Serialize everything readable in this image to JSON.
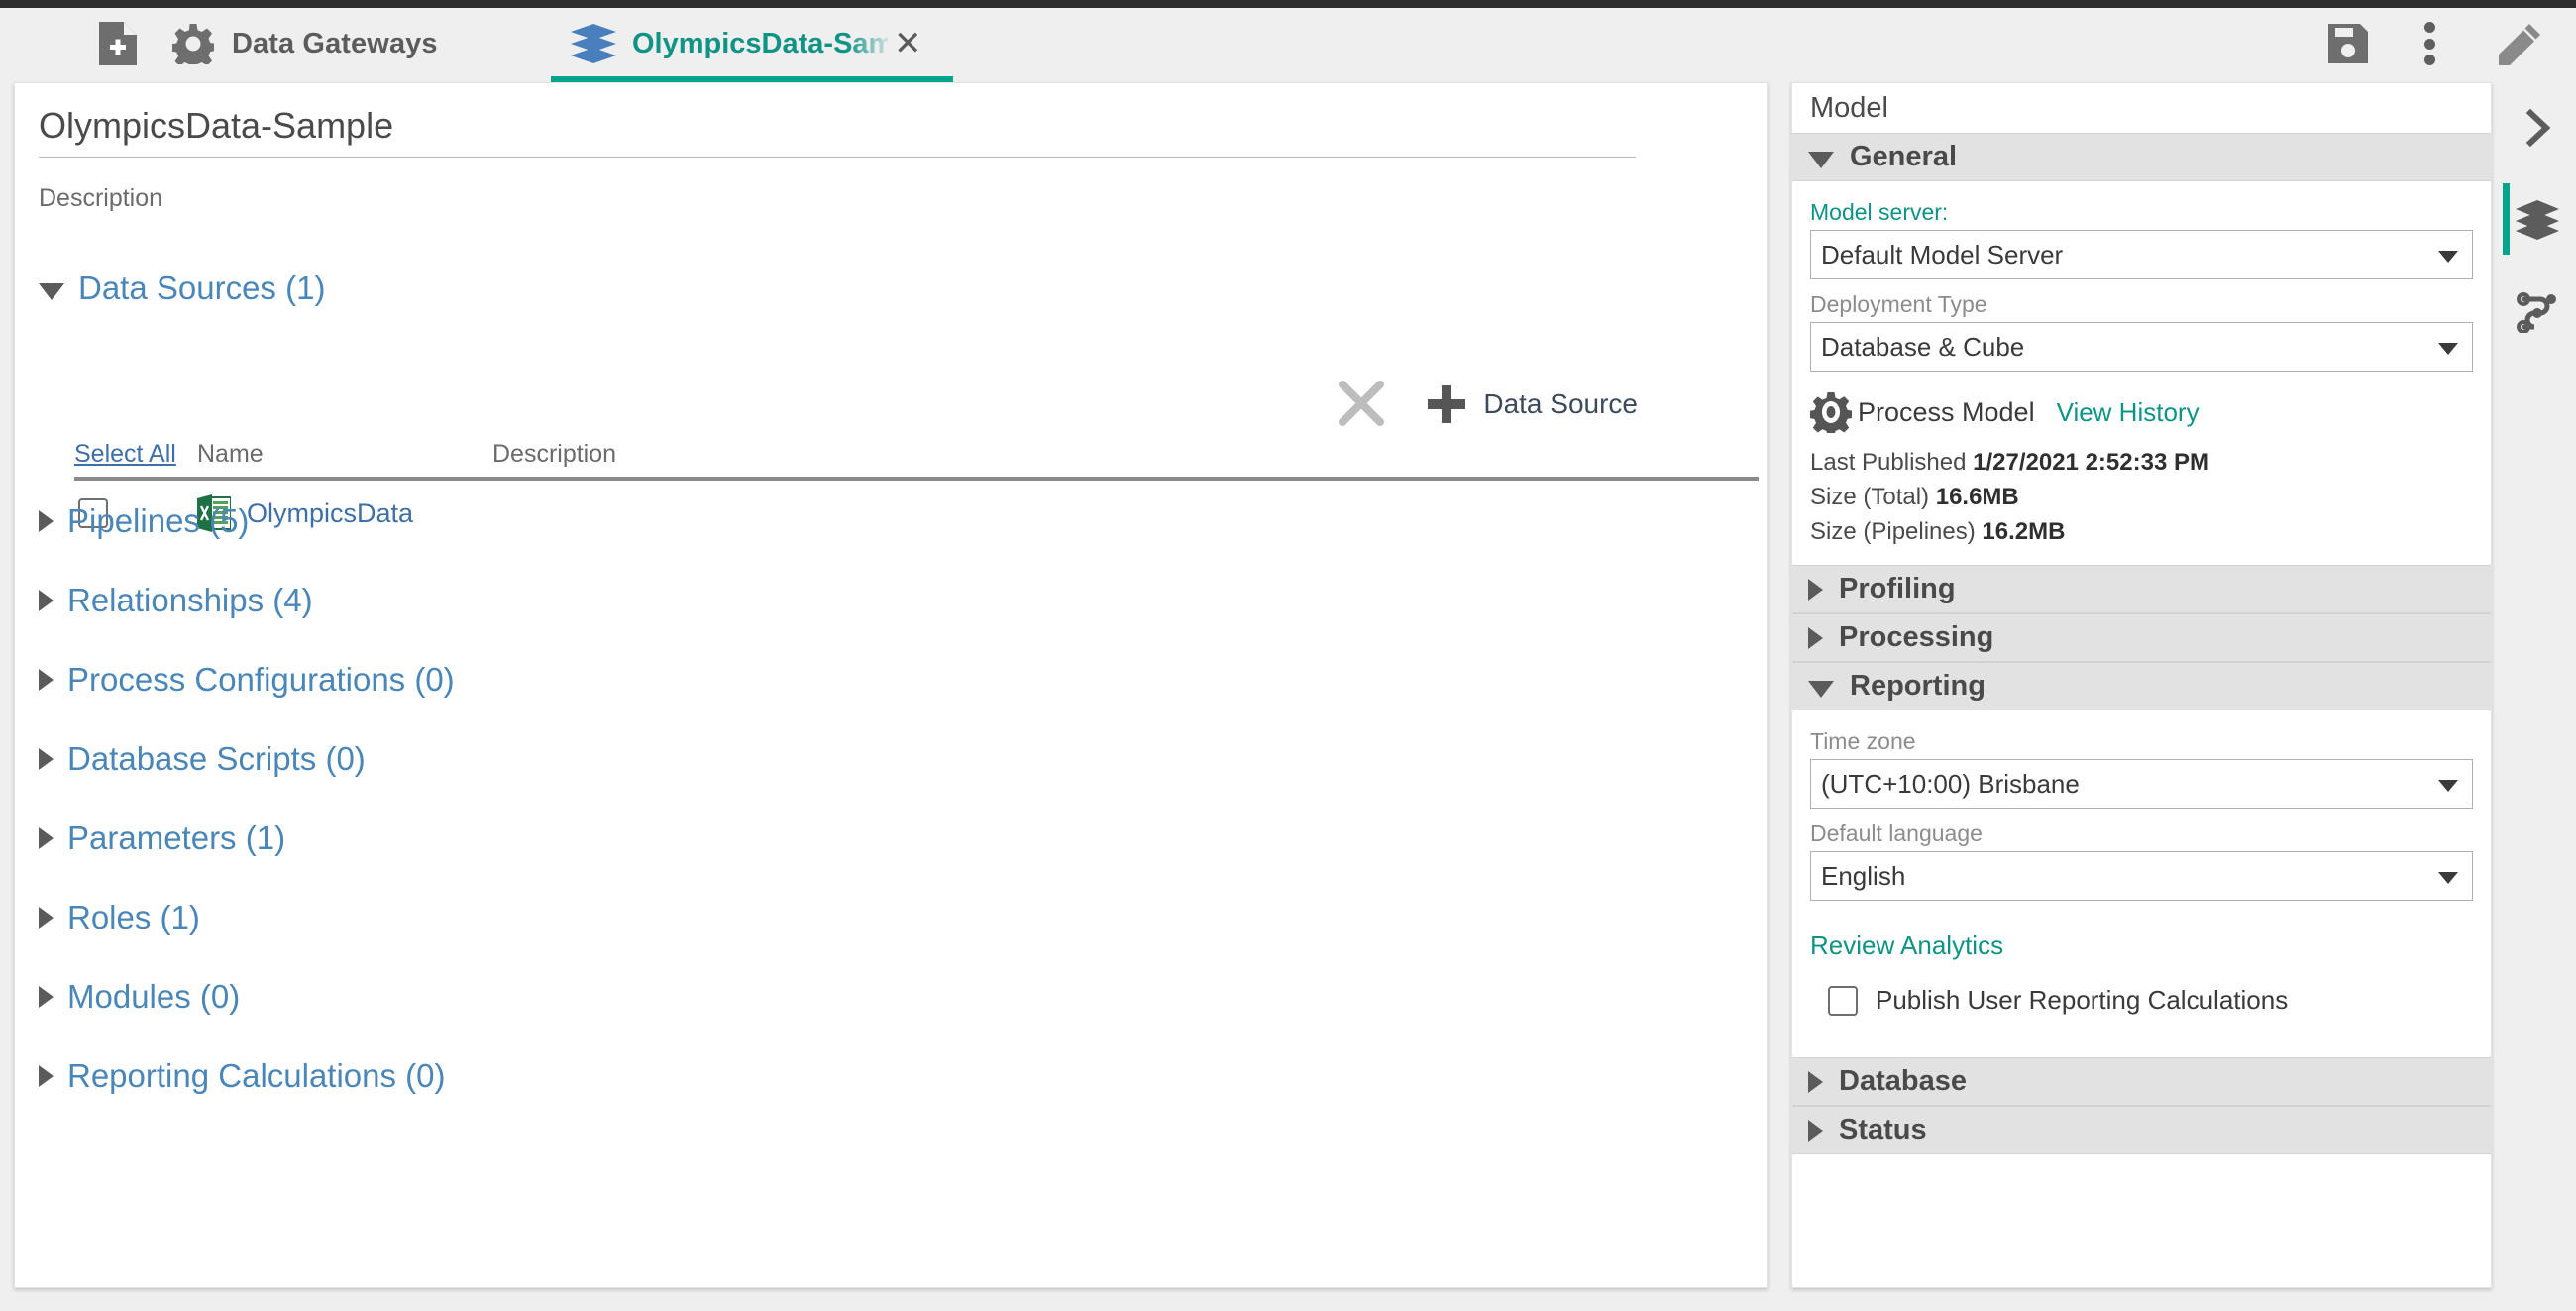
{
  "colors": {
    "accent_teal": "#0e9384",
    "tab_underline": "#00a58c",
    "link_blue": "#4a86b8",
    "panel_gray": "#e2e2e2",
    "excel_green": "#1e7145",
    "layers_blue": "#4a7fbd"
  },
  "toolbar": {
    "menu_icon": "hamburger-menu-icon",
    "new_file_icon": "document-add-icon",
    "gear_icon": "gear-icon",
    "gateways_label": "Data Gateways",
    "save_icon": "save-floppy-icon",
    "overflow_icon": "vertical-dots-icon",
    "edit_icon": "pencil-icon"
  },
  "tab": {
    "icon": "layers-icon",
    "label": "OlympicsData-Sample",
    "close": "✕"
  },
  "main": {
    "title": "OlympicsData-Sample",
    "description_placeholder": "Description",
    "data_sources": {
      "label": "Data Sources (1)",
      "expanded": true,
      "delete_icon": "x-delete-icon",
      "add_label": "Data Source",
      "columns": [
        "Select All",
        "Name",
        "Description"
      ],
      "rows": [
        {
          "checked": false,
          "icon": "excel-file-icon",
          "name": "OlympicsData",
          "description": ""
        }
      ]
    },
    "sections": [
      {
        "label": "Pipelines (5)",
        "expanded": false
      },
      {
        "label": "Relationships (4)",
        "expanded": false
      },
      {
        "label": "Process Configurations (0)",
        "expanded": false
      },
      {
        "label": "Database Scripts (0)",
        "expanded": false
      },
      {
        "label": "Parameters (1)",
        "expanded": false
      },
      {
        "label": "Roles (1)",
        "expanded": false
      },
      {
        "label": "Modules (0)",
        "expanded": false
      },
      {
        "label": "Reporting Calculations (0)",
        "expanded": false
      }
    ]
  },
  "properties": {
    "title": "Model",
    "general": {
      "header": "General",
      "model_server_label": "Model server:",
      "model_server_value": "Default Model Server",
      "deployment_type_label": "Deployment Type",
      "deployment_type_value": "Database & Cube",
      "process_model_icon": "gear-process-icon",
      "process_model_label": "Process Model",
      "view_history_label": "View History",
      "last_published_label": "Last Published",
      "last_published_value": "1/27/2021 2:52:33 PM",
      "size_total_label": "Size (Total)",
      "size_total_value": "16.6MB",
      "size_pipelines_label": "Size (Pipelines)",
      "size_pipelines_value": "16.2MB"
    },
    "profiling": {
      "header": "Profiling"
    },
    "processing": {
      "header": "Processing"
    },
    "reporting": {
      "header": "Reporting",
      "time_zone_label": "Time zone",
      "time_zone_value": "(UTC+10:00) Brisbane",
      "default_language_label": "Default language",
      "default_language_value": "English",
      "review_analytics_label": "Review Analytics",
      "publish_checkbox_label": "Publish User Reporting Calculations",
      "publish_checked": false
    },
    "database": {
      "header": "Database"
    },
    "status": {
      "header": "Status"
    }
  },
  "rail": {
    "items": [
      {
        "icon": "chevron-right-icon",
        "active": false
      },
      {
        "icon": "layers-icon",
        "active": true
      },
      {
        "icon": "relationships-graph-icon",
        "active": false
      }
    ]
  }
}
